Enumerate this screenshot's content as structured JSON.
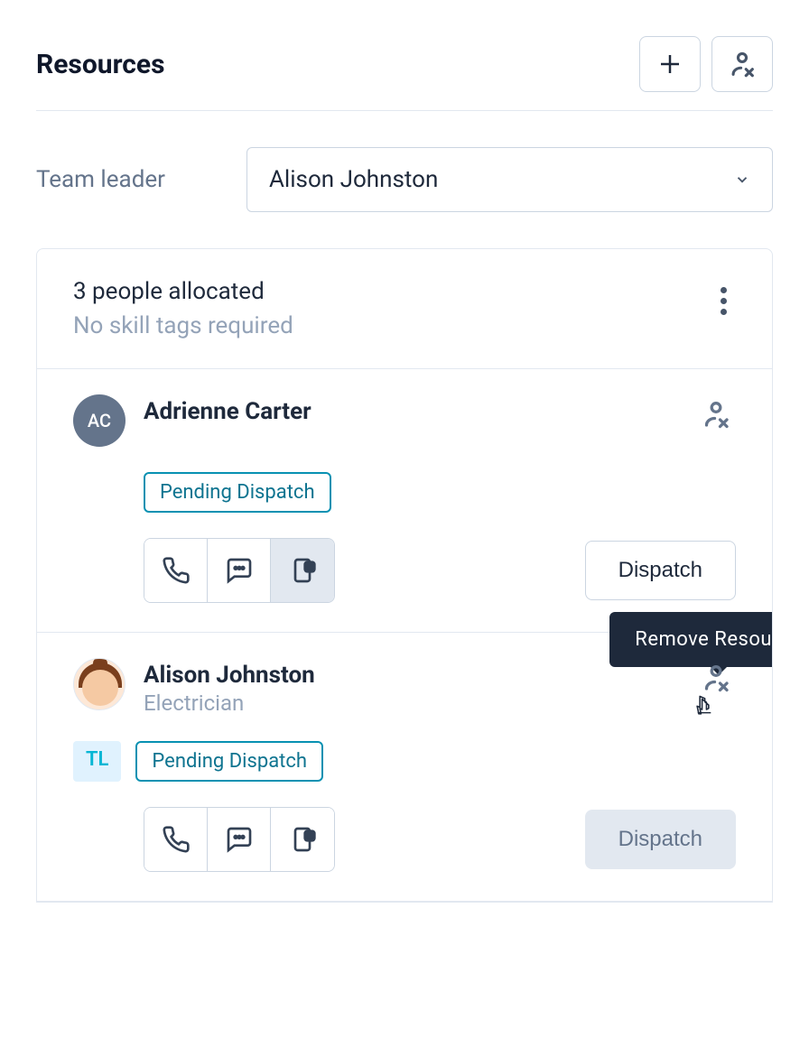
{
  "header": {
    "title": "Resources"
  },
  "team_leader": {
    "label": "Team leader",
    "selected": "Alison Johnston"
  },
  "allocation": {
    "title": "3 people allocated",
    "subtitle": "No skill tags required"
  },
  "resources": [
    {
      "initials": "AC",
      "name": "Adrienne Carter",
      "role": "",
      "status": "Pending Dispatch",
      "tl": false,
      "dispatch_label": "Dispatch",
      "dispatch_disabled": false,
      "notification_active": true
    },
    {
      "initials": "",
      "name": "Alison Johnston",
      "role": "Electrician",
      "status": "Pending Dispatch",
      "tl": true,
      "tl_label": "TL",
      "dispatch_label": "Dispatch",
      "dispatch_disabled": true,
      "notification_active": false
    }
  ],
  "tooltip": {
    "text": "Remove Resource"
  }
}
